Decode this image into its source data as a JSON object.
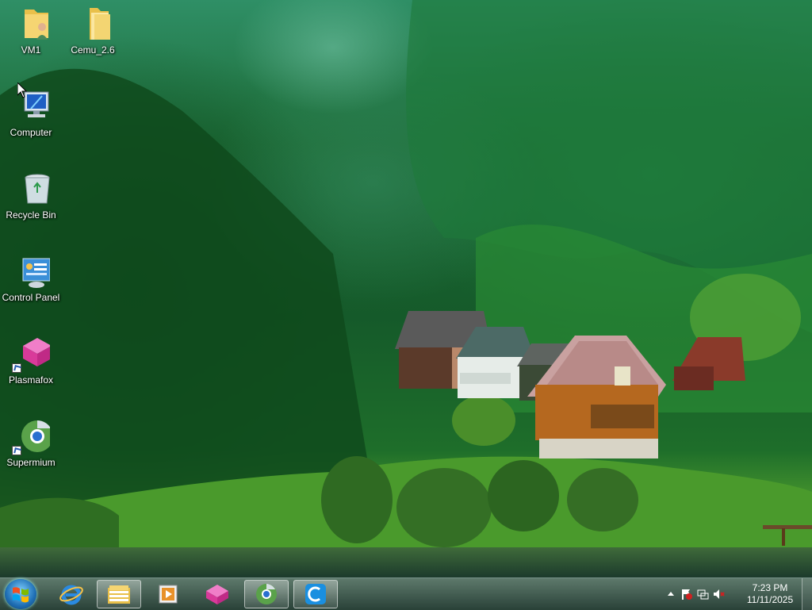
{
  "desktop": {
    "icons": [
      {
        "label": "VM1"
      },
      {
        "label": "Cemu_2.6"
      },
      {
        "label": "Computer"
      },
      {
        "label": "Recycle Bin"
      },
      {
        "label": "Control Panel"
      },
      {
        "label": "Plasmafox"
      },
      {
        "label": "Supermium"
      }
    ]
  },
  "taskbar": {
    "pinned": [
      "internet-explorer-icon",
      "file-explorer-icon",
      "media-player-icon",
      "plasmafox-icon",
      "supermium-icon",
      "cemu-icon"
    ],
    "clock": {
      "time": "7:23 PM",
      "date": "11/11/2025"
    }
  },
  "colors": {
    "accent": "#1f6fb5",
    "taskbar": "#2f4f42"
  }
}
